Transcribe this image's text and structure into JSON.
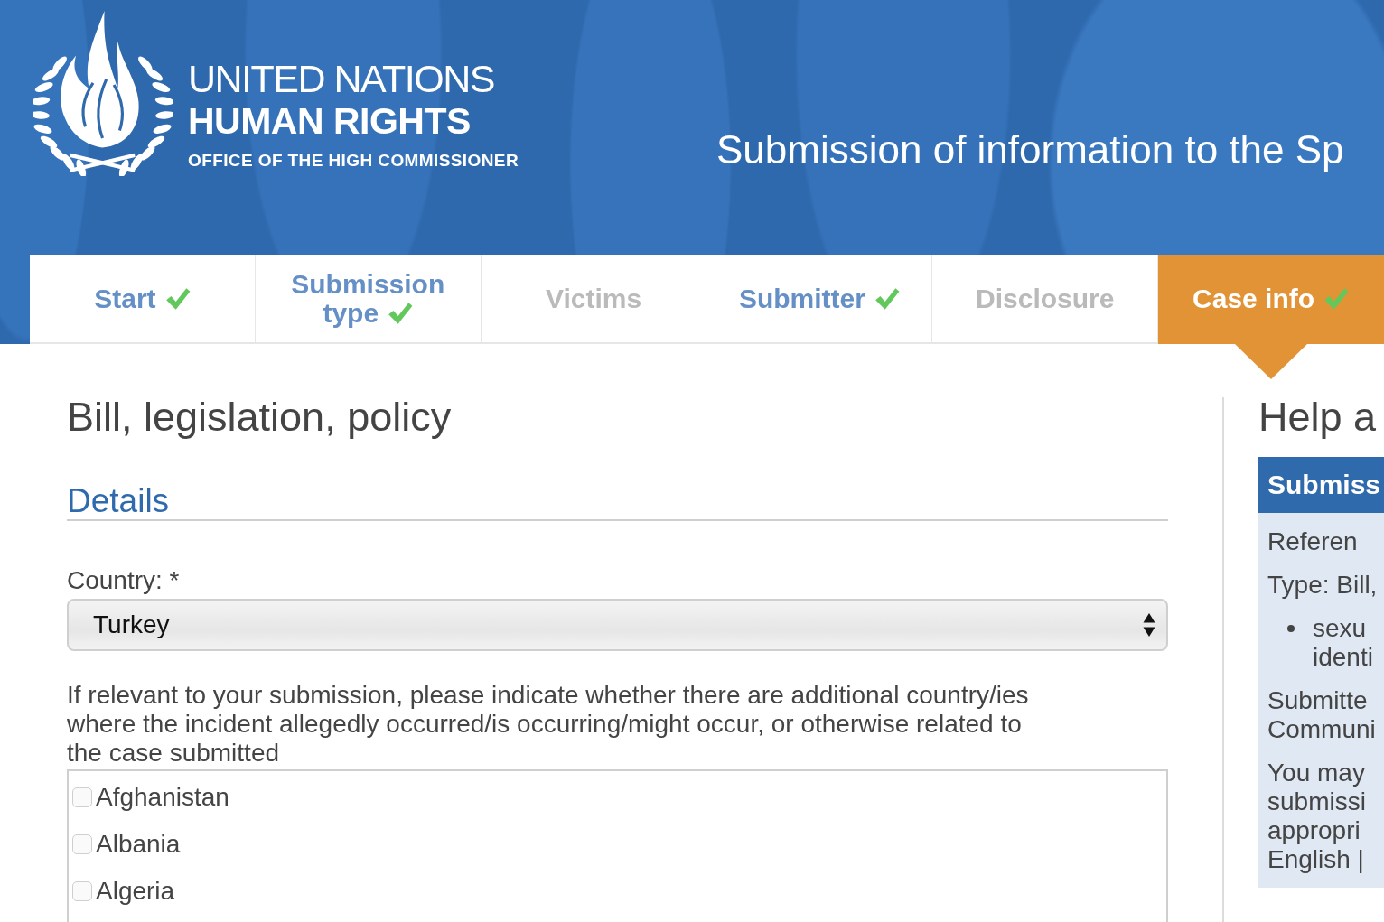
{
  "header": {
    "logo_lines": [
      {
        "text": "UNITED NATIONS",
        "kind": "light"
      },
      {
        "text": "HUMAN RIGHTS",
        "kind": "bold"
      },
      {
        "text": "OFFICE OF THE HIGH COMMISSIONER",
        "kind": "small"
      }
    ],
    "title": "Submission of information to the Sp"
  },
  "steps": [
    {
      "label": "Start",
      "completed": true,
      "selected": false
    },
    {
      "label": "Submission type",
      "completed": true,
      "selected": false
    },
    {
      "label": "Victims",
      "completed": false,
      "selected": false
    },
    {
      "label": "Submitter",
      "completed": true,
      "selected": false
    },
    {
      "label": "Disclosure",
      "completed": false,
      "selected": false
    },
    {
      "label": "Case info",
      "completed": true,
      "selected": true
    }
  ],
  "form": {
    "title": "Bill, legislation, policy",
    "section": "Details",
    "country": {
      "label": "Country: *",
      "value": "Turkey"
    },
    "additional": {
      "prompt": "If relevant to your submission, please indicate whether there are additional country/ies where the incident allegedly occurred/is occurring/might occur, or otherwise related to the case submitted",
      "options": [
        {
          "label": "Afghanistan",
          "checked": false
        },
        {
          "label": "Albania",
          "checked": false
        },
        {
          "label": "Algeria",
          "checked": false
        }
      ]
    }
  },
  "help": {
    "title": "Help a",
    "summary": {
      "heading": "Submiss",
      "paragraphs": [
        {
          "kind": "text",
          "lines": [
            "Referen"
          ]
        },
        {
          "kind": "text",
          "lines": [
            "Type: Bill,"
          ]
        },
        {
          "kind": "bullet",
          "lines": [
            "sexu",
            "identi"
          ]
        },
        {
          "kind": "text",
          "lines": [
            "Submitte",
            "Communi"
          ]
        },
        {
          "kind": "text",
          "lines": [
            "You may",
            "submissi",
            "appropri",
            "English |"
          ]
        }
      ]
    }
  }
}
